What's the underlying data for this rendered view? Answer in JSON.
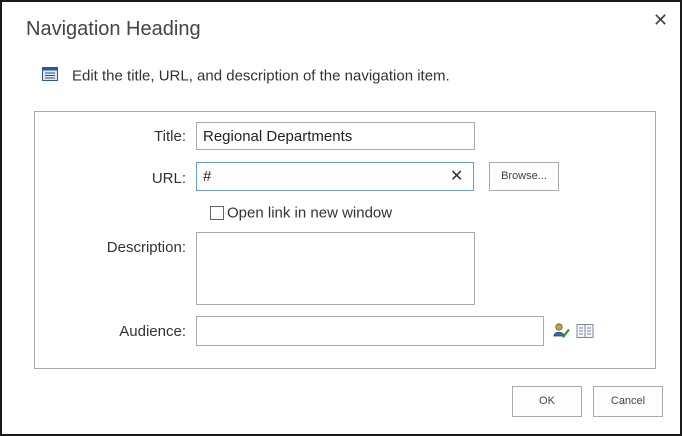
{
  "dialog": {
    "title": "Navigation Heading",
    "close_glyph": "✕",
    "instruction": "Edit the title, URL, and description of the navigation item."
  },
  "form": {
    "title_label": "Title:",
    "title_value": "Regional Departments",
    "url_label": "URL:",
    "url_value": "#",
    "url_clear_glyph": "✕",
    "browse_label": "Browse...",
    "new_window_label": "Open link in new window",
    "new_window_checked": false,
    "description_label": "Description:",
    "description_value": "",
    "audience_label": "Audience:",
    "audience_value": ""
  },
  "buttons": {
    "ok": "OK",
    "cancel": "Cancel"
  },
  "icons": {
    "instruction": "list-icon",
    "check_names": "check-names-icon",
    "browse_directory": "address-book-icon"
  },
  "colors": {
    "border": "#ababab",
    "focus_border": "#6b9ed6",
    "icon_blue": "#2b5797"
  }
}
